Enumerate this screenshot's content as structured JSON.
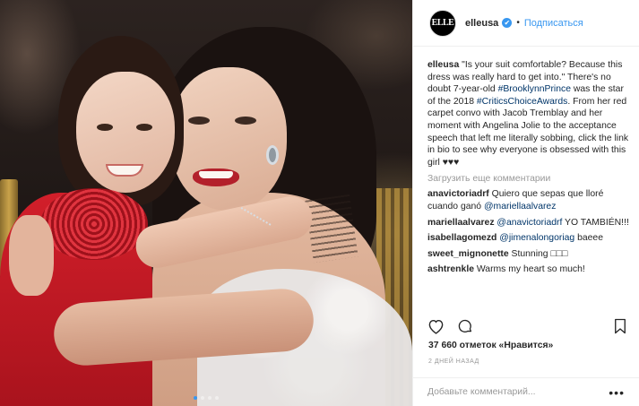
{
  "header": {
    "avatar_text": "ELLE",
    "username": "elleusa",
    "verified_glyph": "✔",
    "separator": "•",
    "follow_label": "Подписаться"
  },
  "caption": {
    "username": "elleusa",
    "text_1": " \"Is your suit comfortable? Because this dress was really hard to get into.\" There's no doubt 7-year-old ",
    "tag_1": "#BrooklynnPrince",
    "text_2": " was the star of the 2018 ",
    "tag_2": "#CriticsChoiceAwards",
    "text_3": ". From her red carpet convo with Jacob Tremblay and her moment with Angelina Jolie to the acceptance speech that left me literally sobbing, click the link in bio to see why everyone is obsessed with this girl ♥♥♥"
  },
  "load_more": "Загрузить еще комментарии",
  "comments": [
    {
      "user": "anavictoriadrf",
      "pre": " Quiero que sepas que lloré cuando ganó ",
      "mention": "@mariellaalvarez",
      "post": ""
    },
    {
      "user": "mariellaalvarez",
      "pre": " ",
      "mention": "@anavictoriadrf",
      "post": " YO TAMBIÉN!!!"
    },
    {
      "user": "isabellagomezd",
      "pre": " ",
      "mention": "@jimenalongoriag",
      "post": " baeee"
    },
    {
      "user": "sweet_mignonette",
      "pre": " Stunning □□□",
      "mention": "",
      "post": ""
    },
    {
      "user": "ashtrenkle",
      "pre": " Warms my heart so much!",
      "mention": "",
      "post": ""
    }
  ],
  "likes": "37 660 отметок «Нравится»",
  "date": "2 ДНЕЙ НАЗАД",
  "add_comment": {
    "placeholder": "Добавьте комментарий...",
    "more_label": "•••"
  },
  "icons": {
    "like": "heart-icon",
    "comment": "comment-icon",
    "save": "bookmark-icon",
    "more": "more-options-icon"
  },
  "colors": {
    "accent": "#3897f0",
    "hashtag": "#003569",
    "muted": "#999999",
    "text": "#262626"
  }
}
